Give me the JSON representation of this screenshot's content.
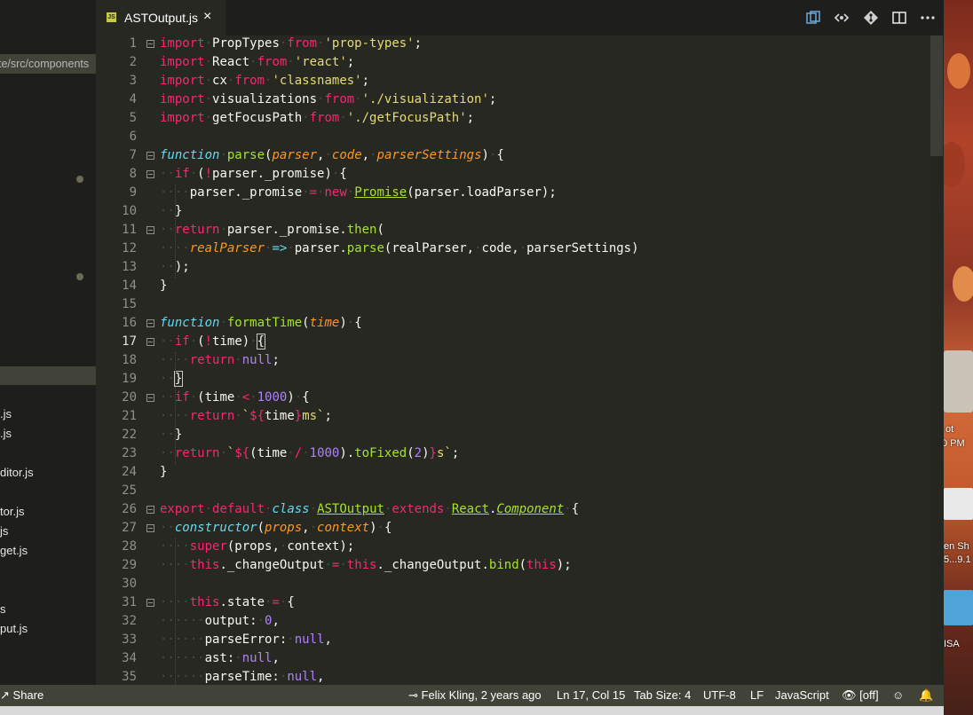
{
  "sidebar": {
    "path": "te/src/components",
    "files": [
      ".js",
      ".js",
      "ditor.js",
      "tor.js",
      "js",
      "get.js",
      "s",
      "put.js"
    ]
  },
  "tab": {
    "title": "ASTOutput.js",
    "badge": "JS",
    "close": "×"
  },
  "toolbar": [
    "open-changes-icon",
    "compare-icon",
    "git-icon",
    "split-editor-icon",
    "more-icon"
  ],
  "editor": {
    "current_line": 17,
    "lines": [
      {
        "n": 1,
        "fold": true,
        "tokens": [
          [
            "k",
            "import"
          ],
          [
            "",
            "·PropTypes·"
          ],
          [
            "k",
            "from"
          ],
          [
            "",
            ""
          ],
          [
            "",
            "·"
          ],
          [
            "s",
            "'prop-types'"
          ],
          [
            "",
            ";"
          ]
        ]
      },
      {
        "n": 2,
        "tokens": [
          [
            "k",
            "import"
          ],
          [
            "",
            "·React·"
          ],
          [
            "k",
            "from"
          ],
          [
            "",
            "·"
          ],
          [
            "s",
            "'react'"
          ],
          [
            "",
            ";"
          ]
        ]
      },
      {
        "n": 3,
        "tokens": [
          [
            "k",
            "import"
          ],
          [
            "",
            "·cx·"
          ],
          [
            "k",
            "from"
          ],
          [
            "",
            "·"
          ],
          [
            "s",
            "'classnames'"
          ],
          [
            "",
            ";"
          ]
        ]
      },
      {
        "n": 4,
        "tokens": [
          [
            "k",
            "import"
          ],
          [
            "",
            "·visualizations·"
          ],
          [
            "k",
            "from"
          ],
          [
            "",
            "·"
          ],
          [
            "s",
            "'./visualization'"
          ],
          [
            "",
            ";"
          ]
        ]
      },
      {
        "n": 5,
        "tokens": [
          [
            "k",
            "import"
          ],
          [
            "",
            "·getFocusPath·"
          ],
          [
            "k",
            "from"
          ],
          [
            "",
            "·"
          ],
          [
            "s",
            "'./getFocusPath'"
          ],
          [
            "",
            ";"
          ]
        ]
      },
      {
        "n": 6,
        "tokens": []
      },
      {
        "n": 7,
        "fold": true,
        "tokens": [
          [
            "st",
            "function"
          ],
          [
            "",
            "·"
          ],
          [
            "f",
            "parse"
          ],
          [
            "",
            "("
          ],
          [
            "p",
            "parser"
          ],
          [
            "",
            ",·"
          ],
          [
            "p",
            "code"
          ],
          [
            "",
            ",·"
          ],
          [
            "p",
            "parserSettings"
          ],
          [
            "",
            ")·{"
          ]
        ]
      },
      {
        "n": 8,
        "fold": true,
        "tokens": [
          [
            "",
            "··"
          ],
          [
            "k",
            "if"
          ],
          [
            "",
            "·("
          ],
          [
            "k",
            "!"
          ],
          [
            "",
            "parser._promise)·{"
          ]
        ]
      },
      {
        "n": 9,
        "tokens": [
          [
            "",
            "····parser._promise·"
          ],
          [
            "k",
            "="
          ],
          [
            "",
            "·"
          ],
          [
            "k",
            "new"
          ],
          [
            "",
            "·"
          ],
          [
            "u",
            "Promise"
          ],
          [
            "",
            "(parser.loadParser);"
          ]
        ]
      },
      {
        "n": 10,
        "tokens": [
          [
            "",
            "··}"
          ]
        ]
      },
      {
        "n": 11,
        "fold": true,
        "tokens": [
          [
            "",
            "··"
          ],
          [
            "k",
            "return"
          ],
          [
            "",
            "·parser._promise."
          ],
          [
            "f",
            "then"
          ],
          [
            "",
            "("
          ]
        ]
      },
      {
        "n": 12,
        "tokens": [
          [
            "",
            "····"
          ],
          [
            "p",
            "realParser"
          ],
          [
            "",
            "·"
          ],
          [
            "st",
            "=>"
          ],
          [
            "",
            "·parser."
          ],
          [
            "f",
            "parse"
          ],
          [
            "",
            "(realParser,·code,·parserSettings)"
          ]
        ]
      },
      {
        "n": 13,
        "tokens": [
          [
            "",
            "··);"
          ]
        ]
      },
      {
        "n": 14,
        "tokens": [
          [
            "",
            "}"
          ]
        ]
      },
      {
        "n": 15,
        "tokens": []
      },
      {
        "n": 16,
        "fold": true,
        "tokens": [
          [
            "st",
            "function"
          ],
          [
            "",
            "·"
          ],
          [
            "f",
            "formatTime"
          ],
          [
            "",
            "("
          ],
          [
            "p",
            "time"
          ],
          [
            "",
            ")·{"
          ]
        ]
      },
      {
        "n": 17,
        "fold": true,
        "tokens": [
          [
            "",
            "··"
          ],
          [
            "k",
            "if"
          ],
          [
            "",
            "·("
          ],
          [
            "k",
            "!"
          ],
          [
            "",
            "time)·"
          ],
          [
            "br",
            "{"
          ]
        ]
      },
      {
        "n": 18,
        "tokens": [
          [
            "",
            "····"
          ],
          [
            "k",
            "return"
          ],
          [
            "",
            "·"
          ],
          [
            "n",
            "null"
          ],
          [
            "",
            ";"
          ]
        ]
      },
      {
        "n": 19,
        "tokens": [
          [
            "",
            "··"
          ],
          [
            "br",
            "}"
          ]
        ]
      },
      {
        "n": 20,
        "fold": true,
        "tokens": [
          [
            "",
            "··"
          ],
          [
            "k",
            "if"
          ],
          [
            "",
            "·(time·"
          ],
          [
            "k",
            "<"
          ],
          [
            "",
            "·"
          ],
          [
            "n",
            "1000"
          ],
          [
            "",
            ")·{"
          ]
        ]
      },
      {
        "n": 21,
        "tokens": [
          [
            "",
            "····"
          ],
          [
            "k",
            "return"
          ],
          [
            "",
            "·"
          ],
          [
            "s",
            "`"
          ],
          [
            "k",
            "${"
          ],
          [
            "",
            "time"
          ],
          [
            "k",
            "}"
          ],
          [
            "s",
            "ms`"
          ],
          [
            "",
            ";"
          ]
        ]
      },
      {
        "n": 22,
        "tokens": [
          [
            "",
            "··}"
          ]
        ]
      },
      {
        "n": 23,
        "tokens": [
          [
            "",
            "··"
          ],
          [
            "k",
            "return"
          ],
          [
            "",
            "·"
          ],
          [
            "s",
            "`"
          ],
          [
            "k",
            "${"
          ],
          [
            "",
            "(time·"
          ],
          [
            "k",
            "/"
          ],
          [
            "",
            "·"
          ],
          [
            "n",
            "1000"
          ],
          [
            "",
            ")."
          ],
          [
            "f",
            "toFixed"
          ],
          [
            "",
            "("
          ],
          [
            "n",
            "2"
          ],
          [
            "",
            ")"
          ],
          [
            "k",
            "}"
          ],
          [
            "s",
            "s`"
          ],
          [
            "",
            ";"
          ]
        ]
      },
      {
        "n": 24,
        "tokens": [
          [
            "",
            "}"
          ]
        ]
      },
      {
        "n": 25,
        "tokens": []
      },
      {
        "n": 26,
        "fold": true,
        "tokens": [
          [
            "k",
            "export"
          ],
          [
            "",
            "·"
          ],
          [
            "k",
            "default"
          ],
          [
            "",
            "·"
          ],
          [
            "st",
            "class"
          ],
          [
            "",
            "·"
          ],
          [
            "u",
            "ASTOutput"
          ],
          [
            "",
            "·"
          ],
          [
            "k",
            "extends"
          ],
          [
            "",
            "·"
          ],
          [
            "u",
            "React"
          ],
          [
            "",
            "."
          ],
          [
            "ui",
            "Component"
          ],
          [
            "",
            "·{"
          ]
        ]
      },
      {
        "n": 27,
        "fold": true,
        "tokens": [
          [
            "",
            "··"
          ],
          [
            "st",
            "constructor"
          ],
          [
            "",
            "("
          ],
          [
            "p",
            "props"
          ],
          [
            "",
            ",·"
          ],
          [
            "p",
            "context"
          ],
          [
            "",
            ")·{"
          ]
        ]
      },
      {
        "n": 28,
        "tokens": [
          [
            "",
            "····"
          ],
          [
            "k",
            "super"
          ],
          [
            "",
            "(props,·context);"
          ]
        ]
      },
      {
        "n": 29,
        "tokens": [
          [
            "",
            "····"
          ],
          [
            "k",
            "this"
          ],
          [
            "",
            "._changeOutput·"
          ],
          [
            "k",
            "="
          ],
          [
            "",
            "·"
          ],
          [
            "k",
            "this"
          ],
          [
            "",
            "._changeOutput."
          ],
          [
            "f",
            "bind"
          ],
          [
            "",
            "("
          ],
          [
            "k",
            "this"
          ],
          [
            "",
            ");"
          ]
        ]
      },
      {
        "n": 30,
        "tokens": []
      },
      {
        "n": 31,
        "fold": true,
        "tokens": [
          [
            "",
            "····"
          ],
          [
            "k",
            "this"
          ],
          [
            "",
            ".state·"
          ],
          [
            "k",
            "="
          ],
          [
            "",
            "·{"
          ]
        ]
      },
      {
        "n": 32,
        "tokens": [
          [
            "",
            "······output:·"
          ],
          [
            "n",
            "0"
          ],
          [
            "",
            ","
          ]
        ]
      },
      {
        "n": 33,
        "tokens": [
          [
            "",
            "······parseError:·"
          ],
          [
            "n",
            "null"
          ],
          [
            "",
            ","
          ]
        ]
      },
      {
        "n": 34,
        "tokens": [
          [
            "",
            "······ast:·"
          ],
          [
            "n",
            "null"
          ],
          [
            "",
            ","
          ]
        ]
      },
      {
        "n": 35,
        "tokens": [
          [
            "",
            "······parseTime:·"
          ],
          [
            "n",
            "null"
          ],
          [
            "",
            ","
          ]
        ]
      }
    ]
  },
  "status": {
    "share": "Share",
    "blame": "Felix Kling, 2 years ago",
    "position": "Ln 17, Col 15",
    "tab_size": "Tab Size: 4",
    "encoding": "UTF-8",
    "eol": "LF",
    "language": "JavaScript",
    "preview": "[off]"
  },
  "desktop": {
    "labels": [
      "ot",
      "0 PM",
      "en Sh",
      "5...9.1",
      "ISA"
    ]
  },
  "colors": {
    "editor_bg": "#272822",
    "keyword": "#f92672",
    "string": "#e6db74",
    "function": "#a6e22e",
    "param": "#fd971f",
    "storage": "#66d9ef",
    "number": "#ae81ff",
    "status_bg": "#414339"
  }
}
